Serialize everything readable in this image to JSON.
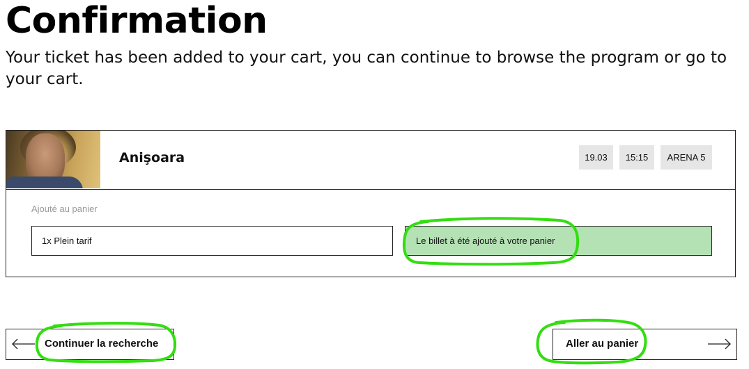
{
  "page": {
    "title": "Confirmation",
    "subtitle": "Your ticket has been added to your cart, you can continue to browse the program or go to your cart."
  },
  "event": {
    "title": "Anişoara",
    "date": "19.03",
    "time": "15:15",
    "venue": "ARENA 5",
    "added_label": "Ajouté au panier",
    "ticket": "1x Plein tarif",
    "status_message": "Le billet à été ajouté à votre panier"
  },
  "actions": {
    "back_label": "Continuer la recherche",
    "cart_label": "Aller au panier",
    "back_icon": "arrow-left-icon",
    "cart_icon": "arrow-right-icon"
  },
  "colors": {
    "status_bg": "#b5e2b5",
    "tag_bg": "#e6e6e6",
    "highlight": "#33dd11"
  }
}
